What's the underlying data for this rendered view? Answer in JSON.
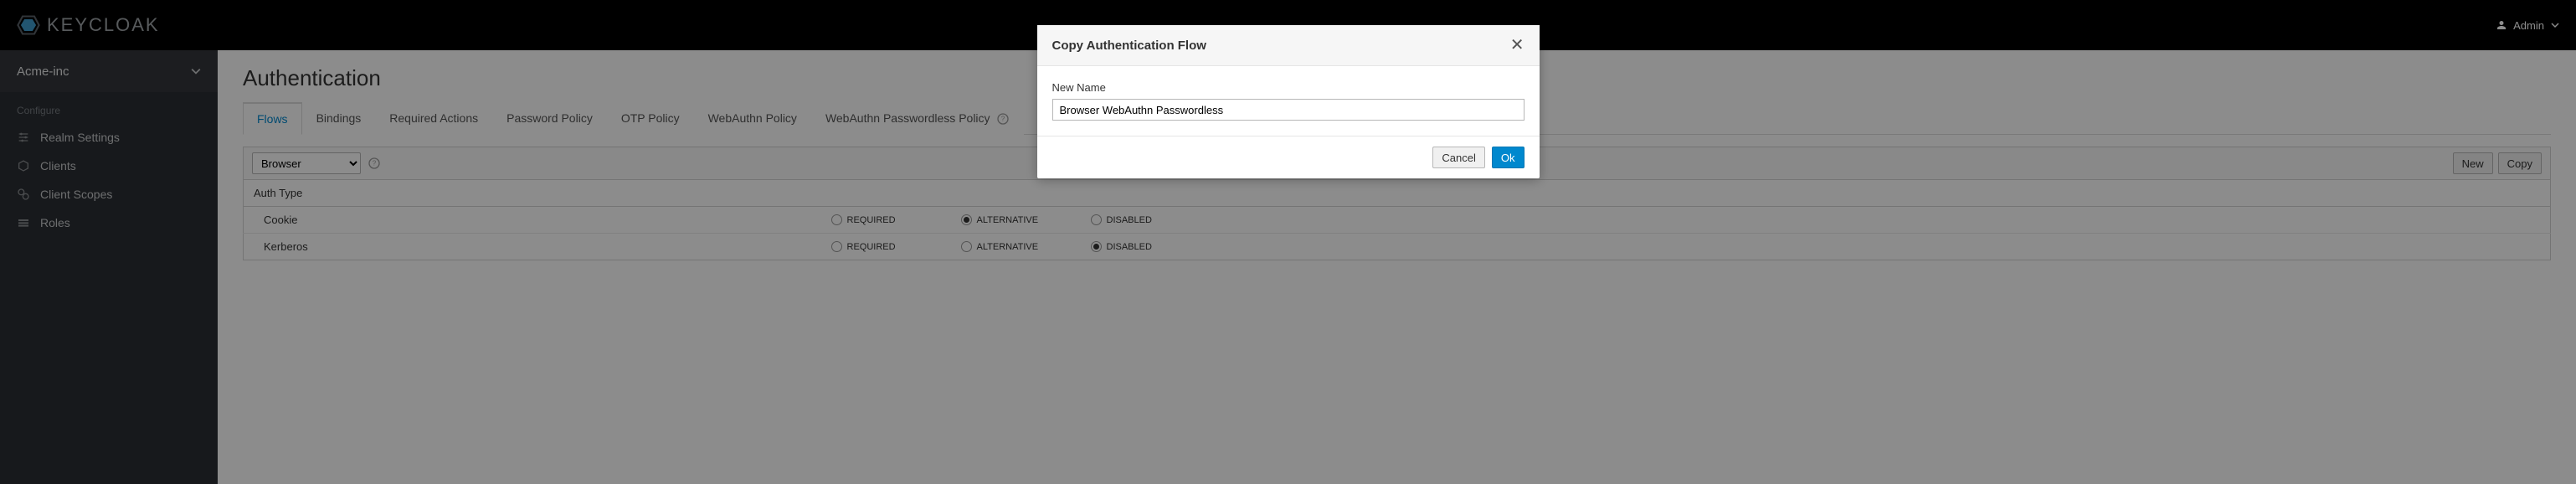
{
  "header": {
    "brand": "KEYCLOAK",
    "user": "Admin"
  },
  "sidebar": {
    "realm": "Acme-inc",
    "section_label": "Configure",
    "items": [
      {
        "label": "Realm Settings"
      },
      {
        "label": "Clients"
      },
      {
        "label": "Client Scopes"
      },
      {
        "label": "Roles"
      }
    ]
  },
  "page": {
    "title": "Authentication",
    "tabs": [
      {
        "label": "Flows",
        "active": true
      },
      {
        "label": "Bindings"
      },
      {
        "label": "Required Actions"
      },
      {
        "label": "Password Policy"
      },
      {
        "label": "OTP Policy"
      },
      {
        "label": "WebAuthn Policy"
      },
      {
        "label": "WebAuthn Passwordless Policy"
      }
    ],
    "flow_select": "Browser",
    "toolbar": {
      "new_label": "New",
      "copy_label": "Copy"
    },
    "table": {
      "col_type": "Auth Type",
      "col_req": "REQUIRED",
      "col_alt": "ALTERNATIVE",
      "col_dis": "DISABLED",
      "rows": [
        {
          "name": "Cookie",
          "required": false,
          "alternative": true,
          "disabled": false
        },
        {
          "name": "Kerberos",
          "required": false,
          "alternative": false,
          "disabled": true
        }
      ]
    }
  },
  "modal": {
    "title": "Copy Authentication Flow",
    "field_label": "New Name",
    "field_value": "Browser WebAuthn Passwordless",
    "cancel": "Cancel",
    "ok": "Ok"
  }
}
